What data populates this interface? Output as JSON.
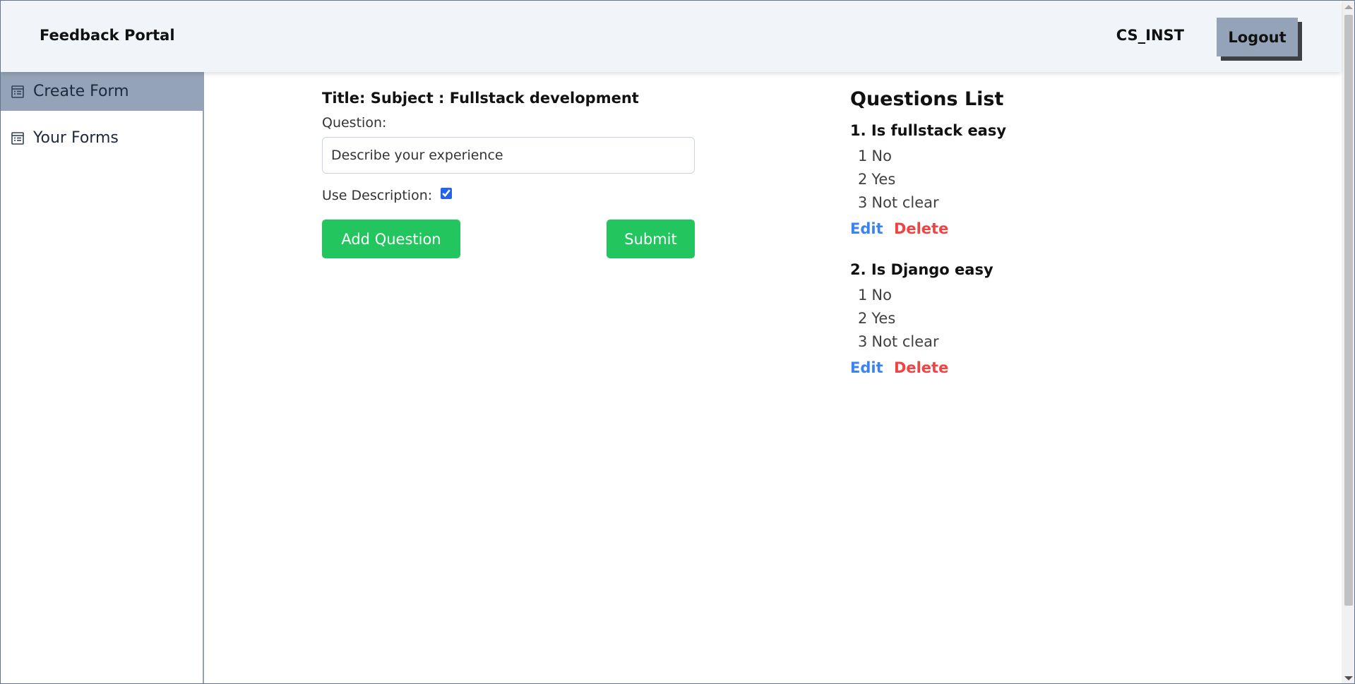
{
  "header": {
    "app_title": "Feedback Portal",
    "username": "CS_INST",
    "logout_label": "Logout"
  },
  "sidebar": {
    "items": [
      {
        "label": "Create Form",
        "icon": "form-icon",
        "active": true
      },
      {
        "label": "Your Forms",
        "icon": "form-icon",
        "active": false
      }
    ]
  },
  "form": {
    "title": "Title: Subject : Fullstack development",
    "question_label": "Question:",
    "question_value": "Describe your experience",
    "use_description_label": "Use Description:",
    "use_description_checked": true,
    "add_question_label": "Add Question",
    "submit_label": "Submit"
  },
  "questions_list": {
    "heading": "Questions List",
    "edit_label": "Edit",
    "delete_label": "Delete",
    "items": [
      {
        "title": "1. Is fullstack easy",
        "options": [
          {
            "num": "1",
            "text": "No"
          },
          {
            "num": "2",
            "text": "Yes"
          },
          {
            "num": "3",
            "text": "Not clear"
          }
        ]
      },
      {
        "title": "2. Is Django easy",
        "options": [
          {
            "num": "1",
            "text": "No"
          },
          {
            "num": "2",
            "text": "Yes"
          },
          {
            "num": "3",
            "text": "Not clear"
          }
        ]
      }
    ]
  },
  "colors": {
    "header_bg": "#f1f5f9",
    "sidebar_active": "#94a3b8",
    "green_button": "#22c55e",
    "edit_link": "#3b82f6",
    "delete_link": "#ef4444"
  }
}
